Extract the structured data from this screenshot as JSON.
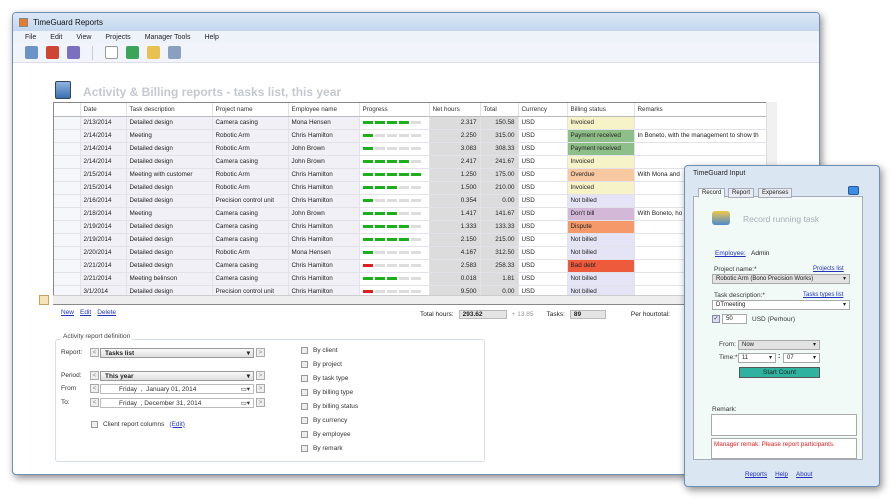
{
  "main": {
    "title": "TimeGuard Reports",
    "menu": [
      "File",
      "Edit",
      "View",
      "Projects",
      "Manager Tools",
      "Help"
    ],
    "heading": "Activity & Billing reports  -  tasks list,  this year",
    "columns": [
      "Date",
      "Task description",
      "Project name",
      "Employee name",
      "Progress",
      "Net hours",
      "Total",
      "Currency",
      "Billing status",
      "Remarks"
    ],
    "rows": [
      [
        "2/13/2014",
        "Detailed design",
        "Camera casing",
        "Mona Hensen",
        4,
        "2.317",
        "150.58",
        "USD",
        "Invoiced",
        ""
      ],
      [
        "2/14/2014",
        "Meeting",
        "Robotic Arm",
        "Chris Hamilton",
        1,
        "2.250",
        "315.00",
        "USD",
        "Payment received",
        "In Boneto, with the management to show th"
      ],
      [
        "2/14/2014",
        "Detailed design",
        "Robotic Arm",
        "John Brown",
        1,
        "3.083",
        "308.33",
        "USD",
        "Payment received",
        ""
      ],
      [
        "2/14/2014",
        "Detailed design",
        "Camera casing",
        "John Brown",
        4,
        "2.417",
        "241.67",
        "USD",
        "Invoiced",
        ""
      ],
      [
        "2/15/2014",
        "Meeting with customer",
        "Robotic Arm",
        "Chris Hamilton",
        5,
        "1.250",
        "175.00",
        "USD",
        "Overdue",
        "With Mona and"
      ],
      [
        "2/15/2014",
        "Detailed design",
        "Robotic Arm",
        "Chris Hamilton",
        3,
        "1.500",
        "210.00",
        "USD",
        "Invoiced",
        ""
      ],
      [
        "2/16/2014",
        "Detailed design",
        "Precision control unit",
        "Chris Hamilton",
        1,
        "0.354",
        "0.00",
        "USD",
        "Not billed",
        ""
      ],
      [
        "2/18/2014",
        "Meeting",
        "Camera casing",
        "John Brown",
        3,
        "1.417",
        "141.67",
        "USD",
        "Don't bill",
        "With Boneto, ho"
      ],
      [
        "2/19/2014",
        "Detailed design",
        "Camera casing",
        "Chris Hamilton",
        4,
        "1.333",
        "133.33",
        "USD",
        "Dispute",
        ""
      ],
      [
        "2/19/2014",
        "Detailed design",
        "Camera casing",
        "Chris Hamilton",
        4,
        "2.150",
        "215.00",
        "USD",
        "Not billed",
        ""
      ],
      [
        "2/20/2014",
        "Detailed design",
        "Robotic Arm",
        "Mona Hensen",
        1,
        "4.167",
        "312.50",
        "USD",
        "Not billed",
        ""
      ],
      [
        "2/21/2014",
        "Detailed design",
        "Camera casing",
        "Chris Hamilton",
        -1,
        "2.583",
        "258.33",
        "USD",
        "Bad debt",
        ""
      ],
      [
        "2/21/2014",
        "Meeting belinson",
        "Camera casing",
        "Chris Hamilton",
        3,
        "0.018",
        "1.81",
        "USD",
        "Not billed",
        ""
      ],
      [
        "3/1/2014",
        "Detailed design",
        "Precision control unit",
        "Chris Hamilton",
        -1,
        "9.500",
        "0.00",
        "USD",
        "Not billed",
        ""
      ]
    ],
    "status_colors": {
      "Invoiced": "#f7f3c8",
      "Payment received": "#8fbf88",
      "Overdue": "#f8c9a0",
      "Not billed": "#e4e4f6",
      "Don't bill": "#d4b8d8",
      "Dispute": "#f5996a",
      "Bad debt": "#ee5a3c"
    },
    "actions": {
      "new": "New",
      "edit": "Edit",
      "delete": "Delete"
    },
    "totals": {
      "hours_label": "Total hours:",
      "hours": "293.62",
      "plus": "+ 13.85",
      "tasks_label": "Tasks:",
      "tasks": "89",
      "perhour_label": "Per hourtotal:"
    },
    "definition": {
      "legend": "Activity report definition",
      "report_label": "Report:",
      "report": "Tasks list",
      "period_label": "Period:",
      "period": "This year",
      "from_label": "From",
      "from_day": "Friday",
      "from_date": "January  01, 2014",
      "to_label": "To:",
      "to_day": "Friday",
      "to_date": "December 31, 2014",
      "client_cols": "Client report columns",
      "edit": "(Edit)",
      "groupings": [
        "By client",
        "By project",
        "By task type",
        "By billing type",
        "By billing status",
        "By currency",
        "By employee",
        "By remark"
      ]
    }
  },
  "input": {
    "title": "TimeGuard Input",
    "tabs": [
      "Record",
      "Report",
      "Expenses"
    ],
    "heading": "Record running task",
    "employee_label": "Employee:",
    "employee": "Admin",
    "project_label": "Project name:*",
    "projects_link": "Projects list",
    "project": "Robotic Arm  (Bono Precision Works)",
    "task_label": "Task description:*",
    "tasks_link": "Tasks types list",
    "task": "DTmeeting",
    "rate": "50",
    "rate_unit": "USD  (Perhour)",
    "from_label": "From:",
    "from": "Now",
    "time_label": "Time:*",
    "hour": "11",
    "minute": "07",
    "start": "Start Count",
    "remark_label": "Remark:",
    "manager_remark": "Manager remak:  Please report participants.",
    "footer": [
      "Reports",
      "Help",
      "About"
    ]
  }
}
